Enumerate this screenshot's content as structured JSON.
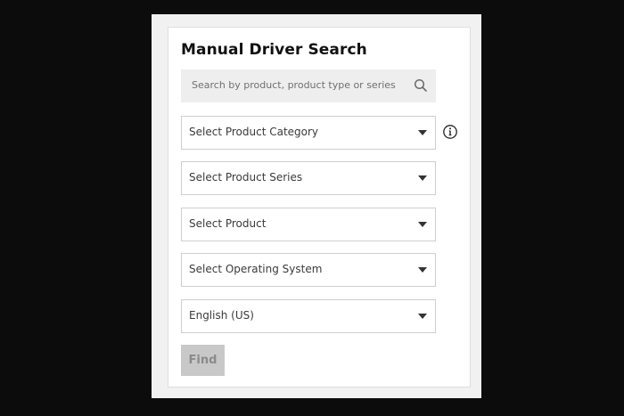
{
  "panel": {
    "title": "Manual Driver Search"
  },
  "search": {
    "placeholder": "Search by product, product type or series",
    "icon": "search-icon"
  },
  "selects": {
    "category": "Select Product Category",
    "series": "Select Product Series",
    "product": "Select Product",
    "os": "Select Operating System",
    "language": "English (US)"
  },
  "info": {
    "icon": "info-icon"
  },
  "find_button": {
    "label": "Find",
    "enabled": false
  },
  "colors": {
    "page_background": "#0c0c0c",
    "card_background": "#ffffff",
    "search_background": "#eeeeee",
    "button_disabled": "#c8c8c8"
  }
}
